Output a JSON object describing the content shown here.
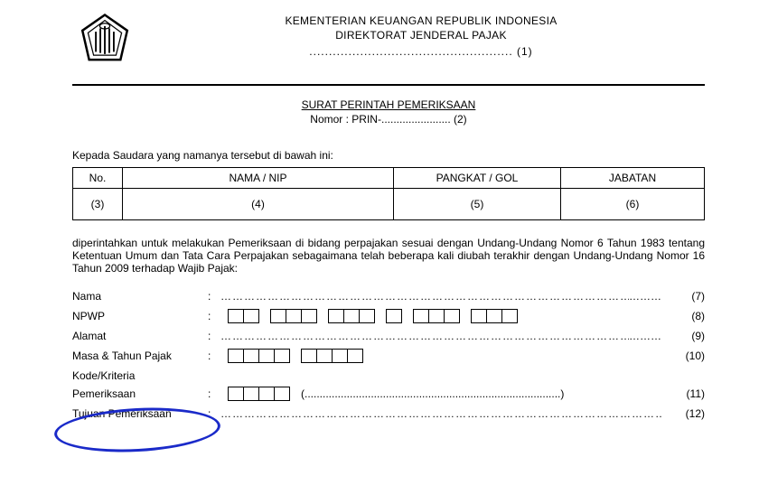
{
  "header": {
    "line1": "KEMENTERIAN KEUANGAN REPUBLIK INDONESIA",
    "line2": "DIREKTORAT JENDERAL PAJAK",
    "fill_line_dots": "....................................................",
    "fill_line_num": "(1)"
  },
  "title": {
    "main": "SURAT PERINTAH PEMERIKSAAN",
    "nomor_prefix": "Nomor : PRIN-",
    "nomor_dots": ".......................",
    "nomor_num": "(2)"
  },
  "intro": "Kepada Saudara yang namanya tersebut di bawah ini:",
  "table": {
    "headers": {
      "no": "No.",
      "nama": "NAMA / NIP",
      "pangkat": "PANGKAT / GOL",
      "jabatan": "JABATAN"
    },
    "cells": {
      "no": "(3)",
      "nama": "(4)",
      "pangkat": "(5)",
      "jabatan": "(6)"
    }
  },
  "paragraph": "diperintahkan untuk melakukan Pemeriksaan di bidang perpajakan sesuai dengan Undang-Undang Nomor 6 Tahun 1983 tentang Ketentuan Umum dan Tata Cara Perpajakan sebagaimana telah beberapa kali diubah terakhir dengan Undang-Undang Nomor 16 Tahun 2009 terhadap Wajib Pajak:",
  "fields": {
    "nama": {
      "label": "Nama",
      "num": "(7)"
    },
    "npwp": {
      "label": "NPWP",
      "num": "(8)"
    },
    "alamat": {
      "label": "Alamat",
      "num": "(9)"
    },
    "masa": {
      "label": "Masa & Tahun Pajak",
      "num": "(10)"
    },
    "kode_top": {
      "label": "Kode/Kriteria"
    },
    "kode_bot": {
      "label": "Pemeriksaan",
      "num": "(11)"
    },
    "tujuan": {
      "label": "Tujuan Pemeriksaan",
      "num": "(12)"
    }
  },
  "misc": {
    "long_dots": "……………………………………………………………………………………………………………",
    "mid_dots": "(.....................................................................................)",
    "end_dots": "………"
  }
}
